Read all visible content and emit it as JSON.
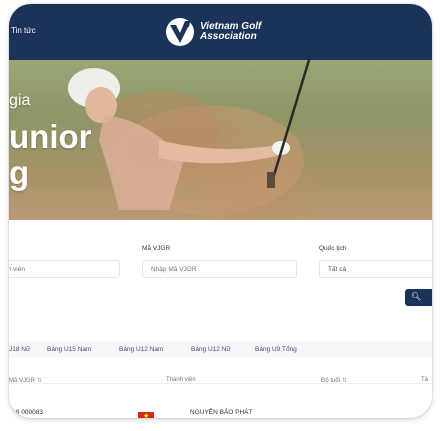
{
  "header": {
    "nav_news": "Tin tức",
    "logo_line1": "Vietnam Golf",
    "logo_line2": "Association"
  },
  "hero": {
    "line1": "gia",
    "line2": "unior",
    "line3": "g"
  },
  "filters": {
    "name_placeholder": "nh viên",
    "vjgr_label": "Mã VJGR",
    "vjgr_placeholder": "Nhập Mã VJGR",
    "nationality_label": "Quốc tịch",
    "nationality_value": "Tất cả",
    "search_icon": "search-icon"
  },
  "tabs": [
    "J18 Nữ",
    "Bảng U15 Nam",
    "Bảng U12 Nam",
    "Bảng U12 Nữ",
    "Bảng U9 Tổng"
  ],
  "table": {
    "headers": {
      "vjgr": "Mã VJGR",
      "member": "Thành viên",
      "age": "Độ tuổi",
      "last": "Tà"
    },
    "rows": [
      {
        "code": "J19 000083",
        "flag": "vietnam-flag-icon",
        "name": "NGUYỄN BẢO PHÁT"
      }
    ]
  },
  "colors": {
    "navy": "#1b3358",
    "flag_red": "#da251d",
    "flag_star": "#ffff00"
  }
}
